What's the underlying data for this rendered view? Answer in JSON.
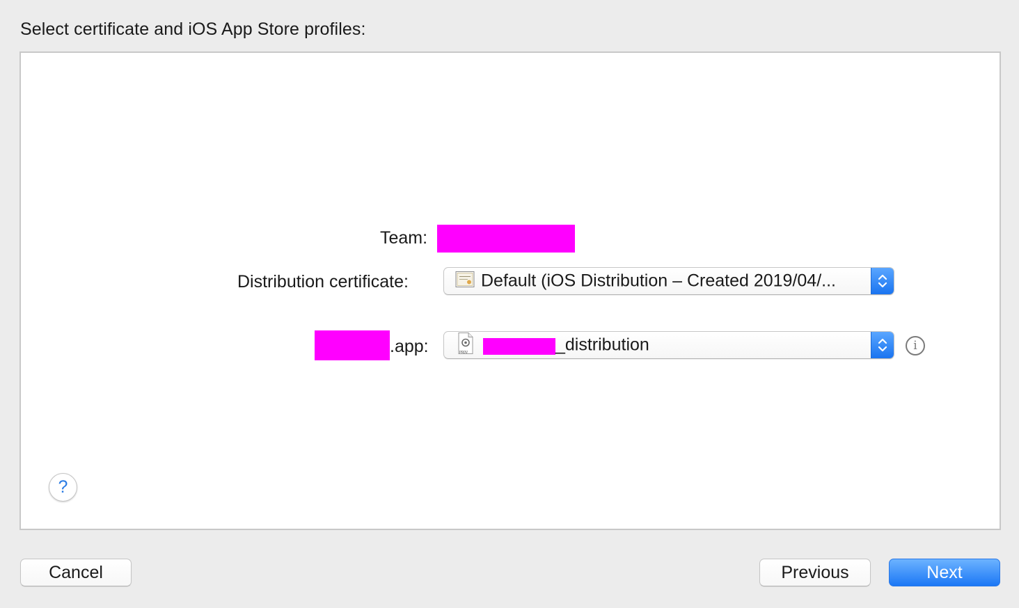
{
  "heading": "Select certificate and iOS App Store profiles:",
  "team": {
    "label": "Team:",
    "value_redacted": true
  },
  "certificate": {
    "label": "Distribution certificate:",
    "selected": "Default (iOS Distribution – Created 2019/04/...",
    "icon": "certificate-icon"
  },
  "profile": {
    "label_suffix": ".app:",
    "selected_suffix": "_distribution",
    "icon": "provisioning-profile-icon",
    "icon_caption": "PROV",
    "info_glyph": "i"
  },
  "help": {
    "glyph": "?"
  },
  "buttons": {
    "cancel": "Cancel",
    "previous": "Previous",
    "next": "Next"
  },
  "colors": {
    "accent": "#1b77f5",
    "redaction": "#ff00ff",
    "window_bg": "#ececec"
  }
}
